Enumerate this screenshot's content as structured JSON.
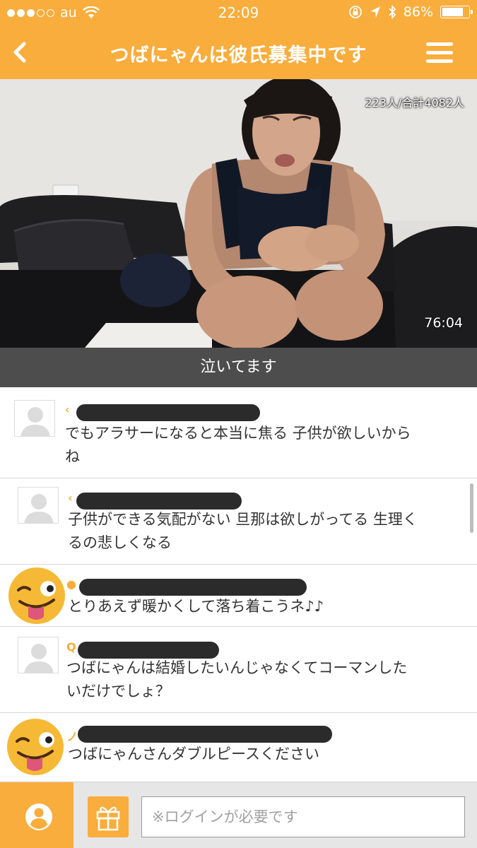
{
  "status_bar": {
    "carrier": "au",
    "time": "22:09",
    "battery": "86%",
    "battery_level": 0.86
  },
  "nav": {
    "title": "つばにゃんは彼氏募集中です"
  },
  "video": {
    "viewer_count": "223人/合計4082人",
    "timer": "76:04"
  },
  "caption": "泣いてます",
  "comments": [
    {
      "icon": "‹",
      "text_line1": "でもアラサーになると本当に焦る 子供が欲しいから",
      "text_line2": "ね"
    },
    {
      "icon": "‹",
      "text_line1": "子供ができる気配がない 旦那は欲しがってる 生理く",
      "text_line2": "るの悲しくなる"
    },
    {
      "icon": "●",
      "text_line1": "とりあえず暖かくして落ち着こうネ♪♪",
      "text_line2": ""
    },
    {
      "icon": "Q",
      "text_line1": "つばにゃんは結婚したいんじゃなくてコーマンした",
      "text_line2": "いだけでしょ？"
    },
    {
      "icon": "ノ",
      "text_line1": "つばにゃんさんダブルピースください",
      "text_line2": ""
    }
  ],
  "input": {
    "placeholder": "※ログインが必要です"
  },
  "colors": {
    "accent": "#f9ad3c",
    "caption_bg": "#4d4d4d"
  }
}
